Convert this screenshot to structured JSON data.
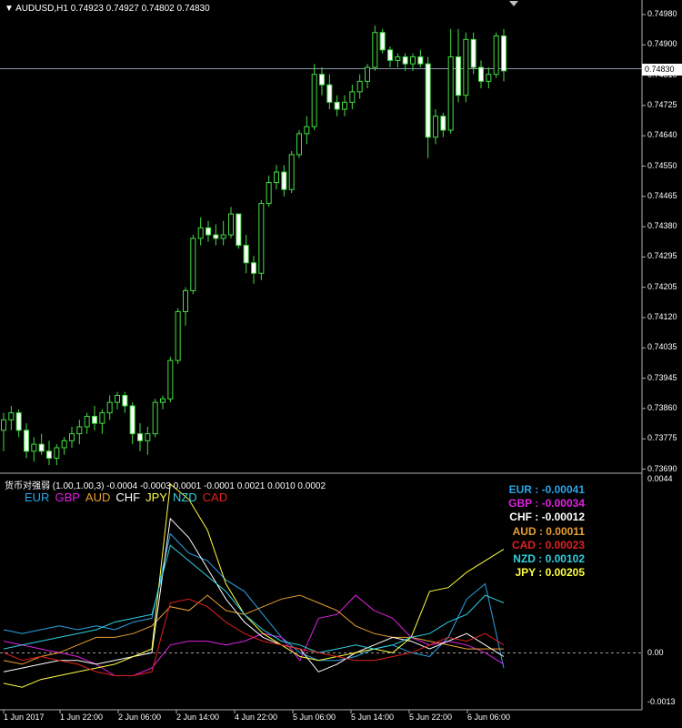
{
  "main_header": {
    "arrow": "▼",
    "symbol": "AUDUSD,H1",
    "ohlc": "0.74923 0.74927 0.74802 0.74830"
  },
  "current_price": "0.74830",
  "price_axis": [
    "0.74980",
    "0.74900",
    "0.74810",
    "0.74725",
    "0.74640",
    "0.74550",
    "0.74465",
    "0.74380",
    "0.74295",
    "0.74205",
    "0.74120",
    "0.74035",
    "0.73945",
    "0.73860",
    "0.73775",
    "0.73690"
  ],
  "indicator_header": "货币对强弱 (1.00,1.00,3) -0.0004 -0.0003 0.0001 -0.0001 0.0021 0.0010 0.0002",
  "indicator_axis": [
    "0.0044",
    "0.00",
    "-0.0013"
  ],
  "legend": [
    {
      "label": "EUR",
      "color": "#2aa3e6"
    },
    {
      "label": "GBP",
      "color": "#e020e0"
    },
    {
      "label": "AUD",
      "color": "#e8a030"
    },
    {
      "label": "CHF",
      "color": "#ffffff"
    },
    {
      "label": "JPY",
      "color": "#ffff40"
    },
    {
      "label": "NZD",
      "color": "#30d0e0"
    },
    {
      "label": "CAD",
      "color": "#e02020"
    }
  ],
  "values": [
    {
      "text": "EUR : -0.00041",
      "color": "#2aa3e6"
    },
    {
      "text": "GBP : -0.00034",
      "color": "#e020e0"
    },
    {
      "text": "CHF : -0.00012",
      "color": "#ffffff"
    },
    {
      "text": "AUD : 0.00011",
      "color": "#e8a030"
    },
    {
      "text": "CAD : 0.00023",
      "color": "#e02020"
    },
    {
      "text": "NZD : 0.00102",
      "color": "#30d0e0"
    },
    {
      "text": "JPY : 0.00205",
      "color": "#ffff40"
    }
  ],
  "time_axis": [
    "1 Jun 2017",
    "1 Jun 22:00",
    "2 Jun 06:00",
    "2 Jun 14:00",
    "4 Jun 22:00",
    "5 Jun 06:00",
    "5 Jun 14:00",
    "5 Jun 22:00",
    "6 Jun 06:00"
  ],
  "chart_data": {
    "type": "candlestick",
    "candle_color": "#44dd44",
    "price_range": [
      0.7369,
      0.7502
    ],
    "candles": [
      [
        0.738,
        0.7385,
        0.7374,
        0.7383
      ],
      [
        0.7383,
        0.7387,
        0.738,
        0.7385
      ],
      [
        0.7385,
        0.7386,
        0.7378,
        0.738
      ],
      [
        0.738,
        0.7382,
        0.7372,
        0.7374
      ],
      [
        0.7374,
        0.7378,
        0.7371,
        0.7376
      ],
      [
        0.7376,
        0.7379,
        0.7373,
        0.7374
      ],
      [
        0.7374,
        0.7377,
        0.737,
        0.7372
      ],
      [
        0.7372,
        0.7376,
        0.737,
        0.7375
      ],
      [
        0.7375,
        0.7378,
        0.7373,
        0.7377
      ],
      [
        0.7377,
        0.7381,
        0.7375,
        0.7379
      ],
      [
        0.7379,
        0.7383,
        0.7376,
        0.7381
      ],
      [
        0.7381,
        0.7385,
        0.7379,
        0.7384
      ],
      [
        0.7384,
        0.7387,
        0.738,
        0.7382
      ],
      [
        0.7382,
        0.7386,
        0.7379,
        0.7385
      ],
      [
        0.7385,
        0.739,
        0.7383,
        0.7388
      ],
      [
        0.7388,
        0.7391,
        0.7386,
        0.739
      ],
      [
        0.739,
        0.7391,
        0.7385,
        0.7387
      ],
      [
        0.7387,
        0.7388,
        0.7376,
        0.7379
      ],
      [
        0.7379,
        0.7382,
        0.7374,
        0.7377
      ],
      [
        0.7377,
        0.7381,
        0.7373,
        0.7379
      ],
      [
        0.7379,
        0.7389,
        0.7378,
        0.7388
      ],
      [
        0.7388,
        0.739,
        0.7386,
        0.7389
      ],
      [
        0.7389,
        0.7401,
        0.7388,
        0.74
      ],
      [
        0.74,
        0.7415,
        0.7399,
        0.7414
      ],
      [
        0.7414,
        0.7421,
        0.741,
        0.742
      ],
      [
        0.742,
        0.7436,
        0.7419,
        0.7435
      ],
      [
        0.7435,
        0.7441,
        0.7433,
        0.7438
      ],
      [
        0.7438,
        0.744,
        0.7434,
        0.7436
      ],
      [
        0.7436,
        0.7439,
        0.7433,
        0.7435
      ],
      [
        0.7435,
        0.744,
        0.7433,
        0.7436
      ],
      [
        0.7436,
        0.7444,
        0.7435,
        0.7442
      ],
      [
        0.7442,
        0.7438,
        0.7432,
        0.7433
      ],
      [
        0.7433,
        0.7436,
        0.7425,
        0.7428
      ],
      [
        0.7428,
        0.743,
        0.7422,
        0.7425
      ],
      [
        0.7425,
        0.7446,
        0.7423,
        0.7445
      ],
      [
        0.7445,
        0.7453,
        0.7444,
        0.7451
      ],
      [
        0.7451,
        0.7456,
        0.7449,
        0.7454
      ],
      [
        0.7454,
        0.7456,
        0.7447,
        0.7449
      ],
      [
        0.7449,
        0.746,
        0.7448,
        0.7459
      ],
      [
        0.7459,
        0.7466,
        0.7458,
        0.7465
      ],
      [
        0.7465,
        0.747,
        0.7462,
        0.7467
      ],
      [
        0.7467,
        0.7485,
        0.7466,
        0.7482
      ],
      [
        0.7482,
        0.7484,
        0.7476,
        0.7479
      ],
      [
        0.7479,
        0.7482,
        0.7472,
        0.7474
      ],
      [
        0.7474,
        0.7476,
        0.747,
        0.7472
      ],
      [
        0.7472,
        0.7476,
        0.747,
        0.7474
      ],
      [
        0.7474,
        0.7479,
        0.7472,
        0.7477
      ],
      [
        0.7477,
        0.7482,
        0.7475,
        0.748
      ],
      [
        0.748,
        0.7485,
        0.7478,
        0.7484
      ],
      [
        0.7484,
        0.7496,
        0.7483,
        0.7494
      ],
      [
        0.7494,
        0.7495,
        0.7488,
        0.7489
      ],
      [
        0.7489,
        0.749,
        0.7484,
        0.7486
      ],
      [
        0.7486,
        0.7488,
        0.7484,
        0.7487
      ],
      [
        0.7487,
        0.7488,
        0.7483,
        0.7485
      ],
      [
        0.7485,
        0.7488,
        0.7483,
        0.7487
      ],
      [
        0.7487,
        0.7489,
        0.7484,
        0.7485
      ],
      [
        0.7485,
        0.7487,
        0.7458,
        0.7464
      ],
      [
        0.7464,
        0.7472,
        0.7462,
        0.747
      ],
      [
        0.747,
        0.7471,
        0.7464,
        0.7466
      ],
      [
        0.7466,
        0.7495,
        0.7465,
        0.7487
      ],
      [
        0.7487,
        0.7495,
        0.7474,
        0.7476
      ],
      [
        0.7476,
        0.7494,
        0.7474,
        0.7492
      ],
      [
        0.7492,
        0.7494,
        0.7482,
        0.7484
      ],
      [
        0.7484,
        0.7486,
        0.7478,
        0.748
      ],
      [
        0.748,
        0.7484,
        0.7478,
        0.7482
      ],
      [
        0.7482,
        0.7494,
        0.7481,
        0.7493
      ],
      [
        0.7493,
        0.7495,
        0.748,
        0.7483
      ]
    ],
    "indicator": {
      "range": [
        -0.0013,
        0.0044
      ],
      "series": [
        {
          "name": "EUR",
          "color": "#2aa3e6",
          "values": [
            0.0006,
            0.0005,
            0.0006,
            0.0007,
            0.0006,
            0.0007,
            0.0006,
            0.0008,
            0.0009,
            0.0031,
            0.0026,
            0.0024,
            0.0019,
            0.0016,
            0.001,
            0.0004,
            0.0,
            -0.0002,
            -0.0002,
            -0.0001,
            0.0001,
            0.0002,
            0.0,
            -0.0001,
            0.0004,
            0.0014,
            0.0018,
            -0.0004
          ]
        },
        {
          "name": "GBP",
          "color": "#e020e0",
          "values": [
            0.0003,
            0.0002,
            0.0001,
            0.0,
            -0.0001,
            -0.0003,
            -0.0006,
            -0.0006,
            -0.0004,
            0.0002,
            0.0003,
            0.0003,
            0.0002,
            0.0003,
            0.0005,
            0.0004,
            -0.0002,
            0.0009,
            0.001,
            0.0015,
            0.0011,
            0.0009,
            0.0004,
            0.0002,
            0.0003,
            0.0002,
            0.0,
            -0.0003
          ]
        },
        {
          "name": "AUD",
          "color": "#e8a030",
          "values": [
            -0.0002,
            -0.0003,
            -0.0001,
            0.0,
            0.0002,
            0.0004,
            0.0004,
            0.0005,
            0.0007,
            0.0012,
            0.0011,
            0.0015,
            0.0011,
            0.001,
            0.0012,
            0.0014,
            0.0015,
            0.0013,
            0.0011,
            0.0007,
            0.0005,
            0.0004,
            0.0004,
            0.0003,
            0.0002,
            0.0001,
            0.0001,
            0.0001
          ]
        },
        {
          "name": "CHF",
          "color": "#ffffff",
          "values": [
            -0.0005,
            -0.0004,
            -0.0003,
            -0.0002,
            -0.0002,
            -0.0003,
            -0.0002,
            -0.0001,
            0.0,
            0.0035,
            0.003,
            0.0022,
            0.0014,
            0.0008,
            0.0004,
            0.0002,
            0.0001,
            -0.0005,
            -0.0003,
            0.0,
            0.0002,
            0.0004,
            0.0003,
            0.0001,
            0.0003,
            0.0005,
            0.0002,
            -0.0001
          ]
        },
        {
          "name": "JPY",
          "color": "#ffff40",
          "values": [
            -0.0008,
            -0.0009,
            -0.0007,
            -0.0006,
            -0.0005,
            -0.0004,
            -0.0003,
            -0.0001,
            0.0001,
            0.0044,
            0.004,
            0.0032,
            0.0018,
            0.001,
            0.0005,
            0.0002,
            -0.0001,
            -0.0002,
            -0.0001,
            0.0,
            0.0001,
            0.0,
            0.0004,
            0.0016,
            0.0017,
            0.0021,
            0.0024,
            0.0027
          ]
        },
        {
          "name": "NZD",
          "color": "#30d0e0",
          "values": [
            0.0001,
            0.0002,
            0.0003,
            0.0004,
            0.0005,
            0.0006,
            0.0008,
            0.0009,
            0.001,
            0.0028,
            0.0024,
            0.002,
            0.0016,
            0.001,
            0.0006,
            0.0003,
            0.0002,
            0.0,
            0.0001,
            0.0002,
            0.0001,
            0.0002,
            0.0004,
            0.0005,
            0.0008,
            0.001,
            0.0015,
            0.0013
          ]
        },
        {
          "name": "CAD",
          "color": "#e02020",
          "values": [
            0.0,
            -0.0002,
            -0.0001,
            -0.0002,
            -0.0003,
            -0.0005,
            -0.0006,
            -0.0006,
            -0.0005,
            0.0013,
            0.0014,
            0.0012,
            0.0008,
            0.0005,
            0.0003,
            0.0002,
            0.0001,
            0.0,
            -0.0001,
            -0.0002,
            -0.0002,
            -0.0001,
            0.0,
            0.0002,
            0.0004,
            0.0003,
            0.0005,
            0.0002
          ]
        }
      ]
    }
  }
}
